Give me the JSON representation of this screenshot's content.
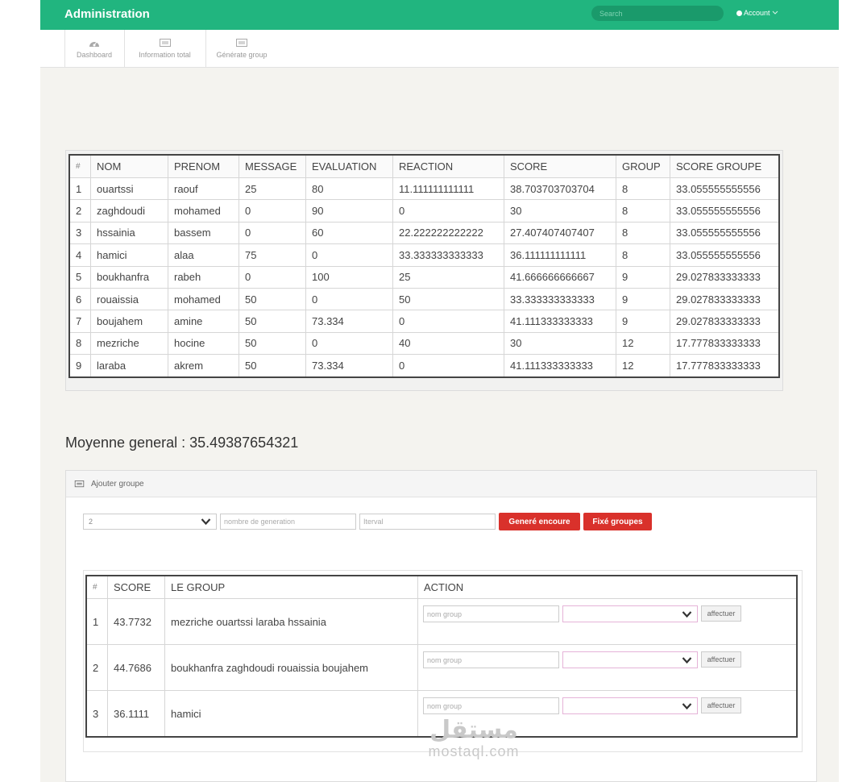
{
  "header": {
    "title": "Administration",
    "search_placeholder": "Search",
    "account_label": "Account",
    "accent_color": "#21b57f"
  },
  "nav": {
    "items": [
      {
        "label": "Dashboard",
        "icon": "dashboard-icon"
      },
      {
        "label": "Information total",
        "icon": "monitor-icon"
      },
      {
        "label": "Générate group",
        "icon": "monitor-icon"
      }
    ]
  },
  "students_table": {
    "headers": [
      "#",
      "NOM",
      "PRENOM",
      "MESSAGE",
      "EVALUATION",
      "REACTION",
      "SCORE",
      "GROUP",
      "SCORE GROUPE"
    ],
    "rows": [
      [
        "1",
        "ouartssi",
        "raouf",
        "25",
        "80",
        "11.111111111111",
        "38.703703703704",
        "8",
        "33.055555555556"
      ],
      [
        "2",
        "zaghdoudi",
        "mohamed",
        "0",
        "90",
        "0",
        "30",
        "8",
        "33.055555555556"
      ],
      [
        "3",
        "hssainia",
        "bassem",
        "0",
        "60",
        "22.222222222222",
        "27.407407407407",
        "8",
        "33.055555555556"
      ],
      [
        "4",
        "hamici",
        "alaa",
        "75",
        "0",
        "33.333333333333",
        "36.111111111111",
        "8",
        "33.055555555556"
      ],
      [
        "5",
        "boukhanfra",
        "rabeh",
        "0",
        "100",
        "25",
        "41.666666666667",
        "9",
        "29.027833333333"
      ],
      [
        "6",
        "rouaissia",
        "mohamed",
        "50",
        "0",
        "50",
        "33.333333333333",
        "9",
        "29.027833333333"
      ],
      [
        "7",
        "boujahem",
        "amine",
        "50",
        "73.334",
        "0",
        "41.111333333333",
        "9",
        "29.027833333333"
      ],
      [
        "8",
        "mezriche",
        "hocine",
        "50",
        "0",
        "40",
        "30",
        "12",
        "17.777833333333"
      ],
      [
        "9",
        "laraba",
        "akrem",
        "50",
        "73.334",
        "0",
        "41.111333333333",
        "12",
        "17.777833333333"
      ]
    ]
  },
  "moyenne": {
    "text": "Moyenne general : 35.49387654321"
  },
  "ajouter": {
    "title": "Ajouter groupe",
    "select_value": "2",
    "generation_placeholder": "nombre de generation",
    "interval_placeholder": "Iterval",
    "btn_generate": "Generé encoure",
    "btn_fix": "Fixé groupes"
  },
  "groups_table": {
    "headers": [
      "#",
      "SCORE",
      "LE GROUP",
      "ACTION"
    ],
    "name_placeholder": "nom group",
    "assign_label": "affectuer",
    "rows": [
      [
        "1",
        "43.7732",
        "mezriche ouartssi laraba hssainia"
      ],
      [
        "2",
        "44.7686",
        "boukhanfra zaghdoudi rouaissia boujahem"
      ],
      [
        "3",
        "36.1111",
        "hamici"
      ]
    ]
  },
  "watermark": {
    "arabic": "مستقل",
    "latin": "mostaql.com"
  }
}
